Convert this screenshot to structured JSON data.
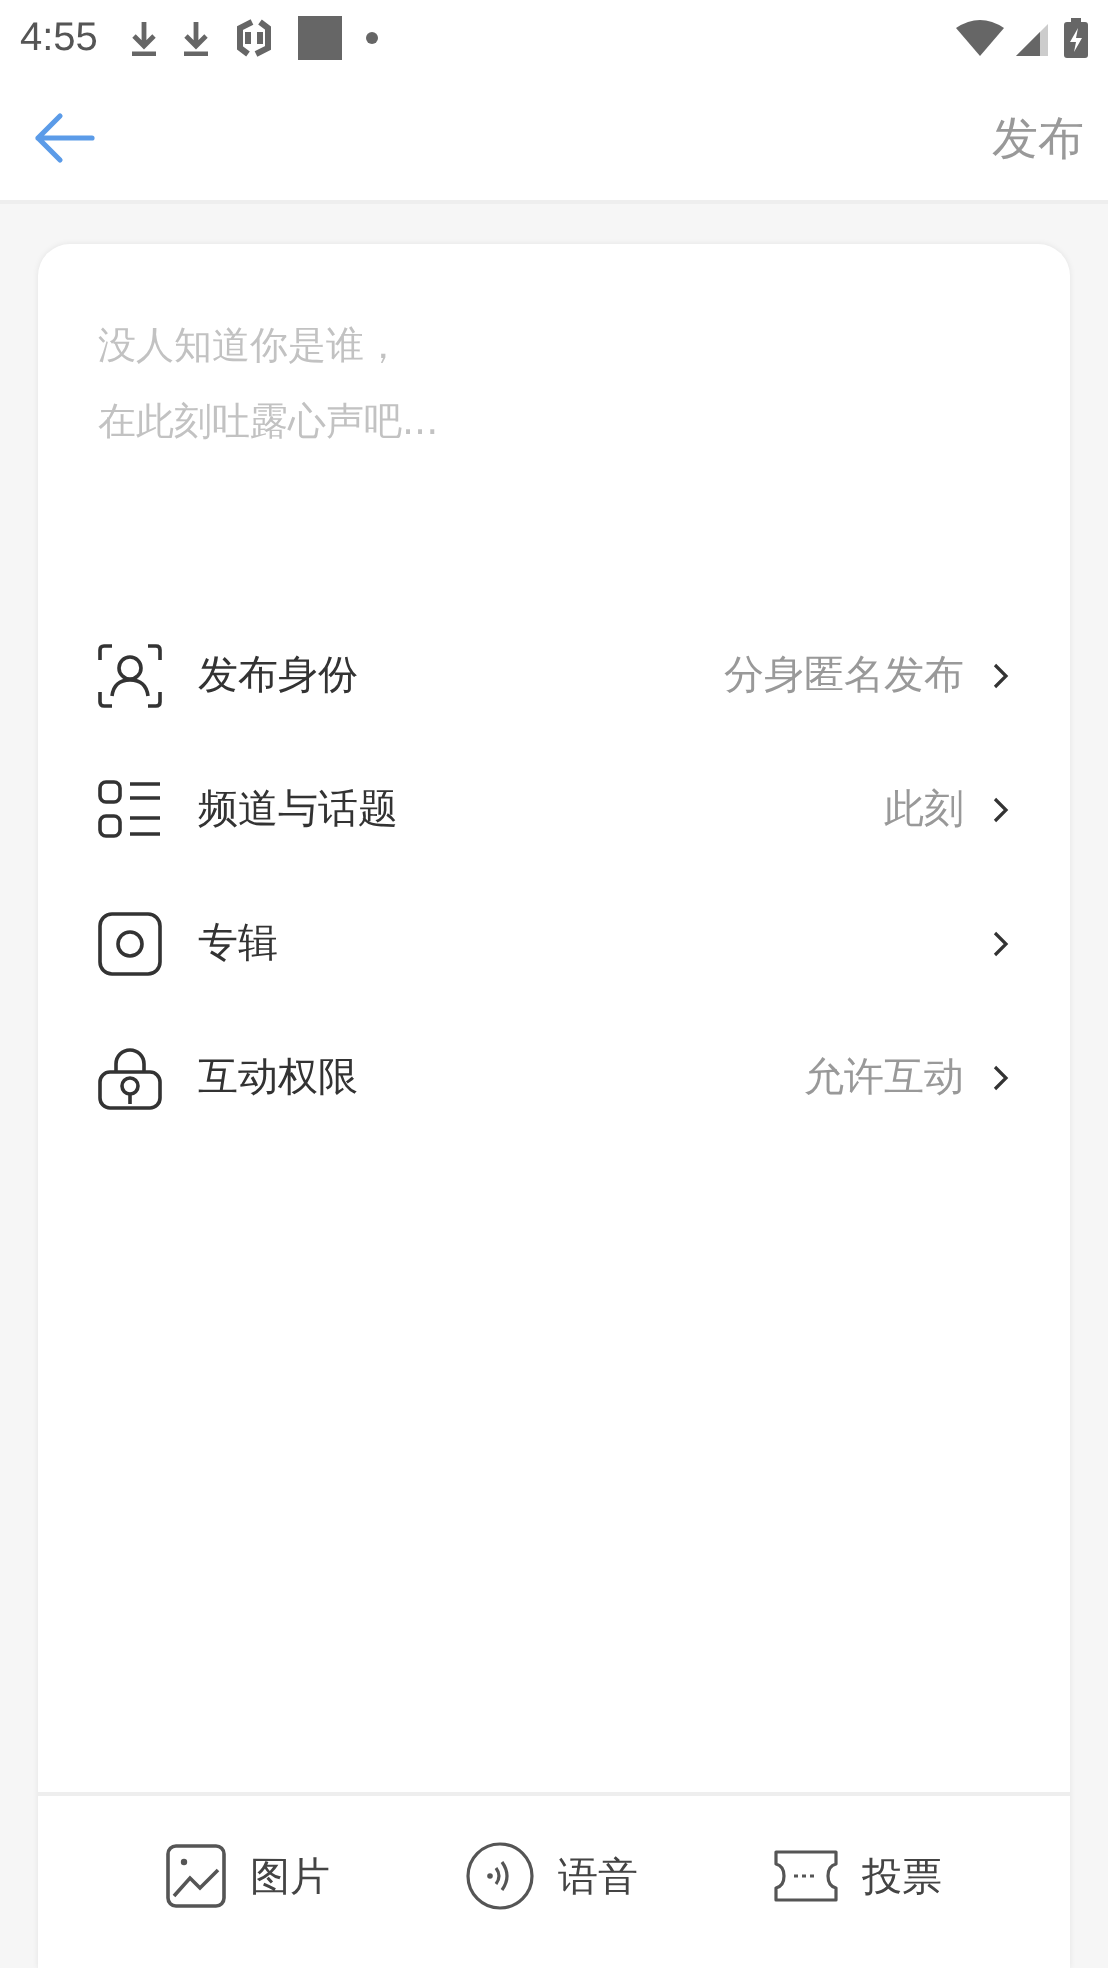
{
  "status_bar": {
    "time": "4:55"
  },
  "app_bar": {
    "action": "发布"
  },
  "composer": {
    "placeholder": "没人知道你是谁，在此刻吐露心声吧..."
  },
  "settings": [
    {
      "kind": "identity",
      "label": "发布身份",
      "value": "分身匿名发布"
    },
    {
      "kind": "channel",
      "label": "频道与话题",
      "value": "此刻"
    },
    {
      "kind": "album",
      "label": "专辑"
    },
    {
      "kind": "permission",
      "label": "互动权限",
      "value": "允许互动"
    }
  ],
  "toolbar": [
    {
      "kind": "image",
      "label": "图片"
    },
    {
      "kind": "voice",
      "label": "语音"
    },
    {
      "kind": "vote",
      "label": "投票"
    }
  ]
}
